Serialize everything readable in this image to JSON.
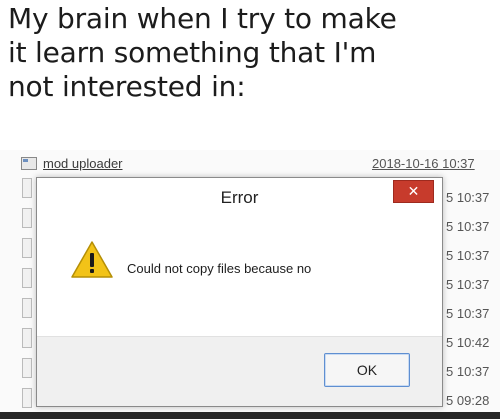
{
  "caption": {
    "line1": "My brain when I try to make",
    "line2": "it learn something that I'm",
    "line3": "not interested in:"
  },
  "explorer": {
    "file_name": "mod uploader",
    "date_header": "2018-10-16 10:37",
    "times": [
      "5 10:37",
      "5 10:37",
      "5 10:37",
      "5 10:37",
      "5 10:37",
      "5 10:42",
      "5 10:37",
      "5 09:28"
    ]
  },
  "dialog": {
    "title": "Error",
    "close_label": "✕",
    "message": "Could not copy files because no",
    "ok_label": "OK",
    "icon": "warning-icon",
    "colors": {
      "close": "#c73b2c",
      "warning": "#f2c318",
      "ok_border": "#5f8fd1"
    }
  }
}
